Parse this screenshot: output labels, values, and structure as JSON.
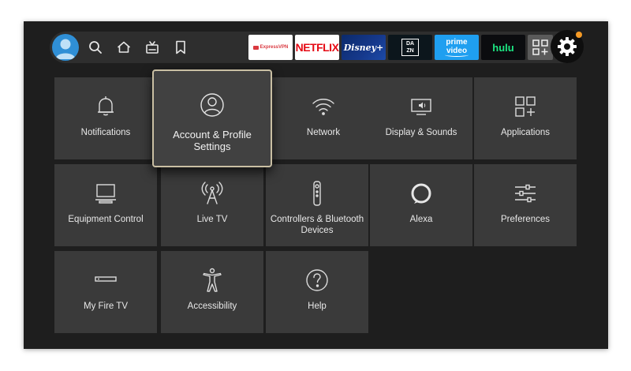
{
  "nav": {
    "icons": [
      "profile-avatar",
      "search-icon",
      "home-icon",
      "live-tv-icon",
      "bookmark-icon"
    ],
    "apps": [
      {
        "id": "expressvpn",
        "label": "ExpressVPN"
      },
      {
        "id": "netflix",
        "label": "NETFLIX"
      },
      {
        "id": "disney",
        "label": "Disney+"
      },
      {
        "id": "dazn",
        "label_top": "DA",
        "label_bottom": "ZN"
      },
      {
        "id": "prime",
        "label": "prime video"
      },
      {
        "id": "hulu",
        "label": "hulu"
      }
    ],
    "accent_dot_color": "#f59a25"
  },
  "settings": {
    "tiles": [
      {
        "label": "Notifications",
        "icon": "bell-icon"
      },
      {
        "label": "Account & Profile Settings",
        "icon": "profile-icon"
      },
      {
        "label": "Network",
        "icon": "wifi-icon"
      },
      {
        "label": "Display & Sounds",
        "icon": "display-sound-icon"
      },
      {
        "label": "Applications",
        "icon": "apps-grid-icon"
      },
      {
        "label": "Equipment Control",
        "icon": "monitor-icon"
      },
      {
        "label": "Live TV",
        "icon": "antenna-icon"
      },
      {
        "label": "Controllers & Bluetooth Devices",
        "icon": "remote-icon"
      },
      {
        "label": "Alexa",
        "icon": "alexa-icon"
      },
      {
        "label": "Preferences",
        "icon": "sliders-icon"
      },
      {
        "label": "My Fire TV",
        "icon": "fire-tv-stick-icon"
      },
      {
        "label": "Accessibility",
        "icon": "accessibility-icon"
      },
      {
        "label": "Help",
        "icon": "help-icon"
      }
    ],
    "focused_index": 1
  }
}
